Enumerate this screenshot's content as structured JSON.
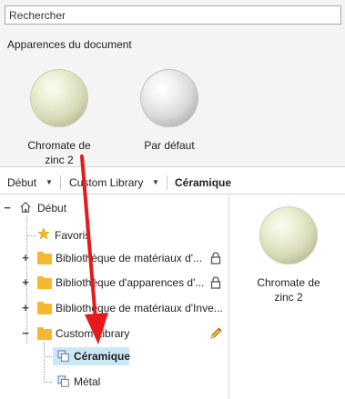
{
  "search": {
    "placeholder": "Rechercher"
  },
  "document_appearances": {
    "title": "Apparences du document",
    "items": [
      {
        "label": "Chromate de zinc 2"
      },
      {
        "label": "Par défaut"
      }
    ]
  },
  "breadcrumb": {
    "items": [
      {
        "label": "Début"
      },
      {
        "label": "Custom Library"
      },
      {
        "label": "Céramique"
      }
    ]
  },
  "tree": {
    "root": "Début",
    "items": [
      {
        "label": "Favoris"
      },
      {
        "label": "Bibliothèque de matériaux d'..."
      },
      {
        "label": "Bibliothèque d'apparences d'..."
      },
      {
        "label": "Bibliothèque de matériaux d'Inve..."
      },
      {
        "label": "Custom Library"
      },
      {
        "label": "Céramique"
      },
      {
        "label": "Métal"
      }
    ]
  },
  "preview": {
    "items": [
      {
        "label": "Chromate de zinc 2"
      }
    ]
  },
  "colors": {
    "folder": "#f5b82e",
    "selection": "#cce8f6",
    "annotation_arrow": "#e41b1b"
  }
}
